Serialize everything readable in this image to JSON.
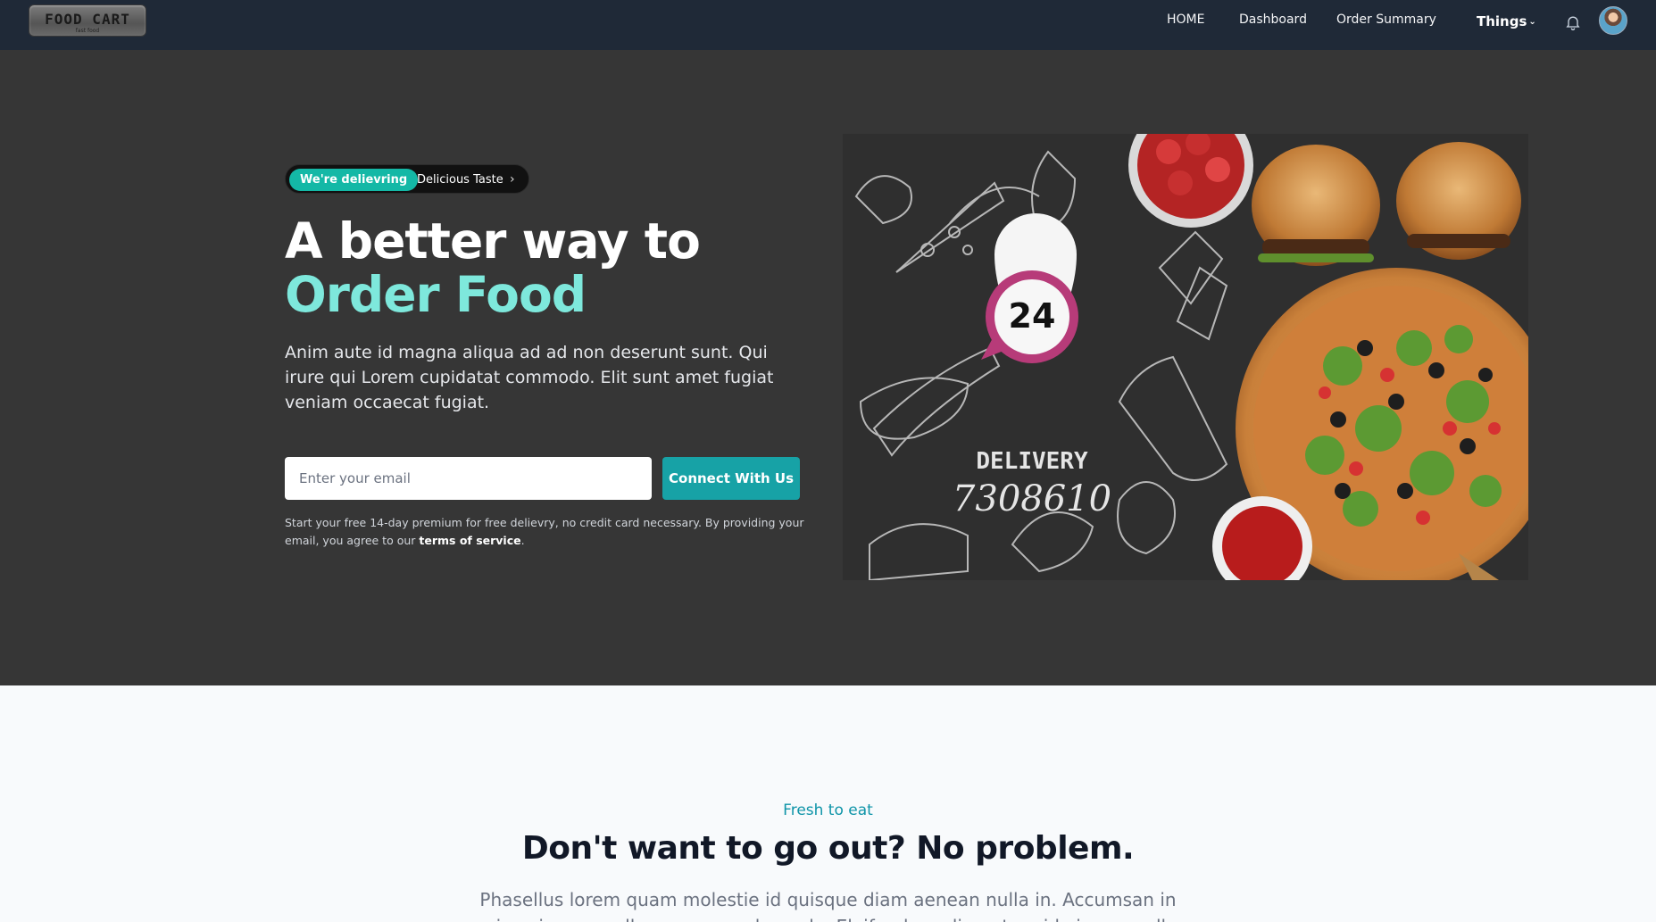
{
  "nav": {
    "logo_text": "FOOD CART",
    "logo_sub": "fast food",
    "links": [
      "HOME",
      "Dashboard",
      "Order Summary"
    ],
    "dropdown": "Things"
  },
  "hero": {
    "badge": "We're delievring",
    "badge_text": "Delicious Taste",
    "title_line1": "A better way to",
    "title_line2": "Order Food",
    "lead": "Anim aute id magna aliqua ad ad non deserunt sunt. Qui irure qui Lorem cupidatat commodo. Elit sunt amet fugiat veniam occaecat fugiat.",
    "email_placeholder": "Enter your email",
    "cta": "Connect With Us",
    "fine_print": "Start your free 14-day premium for free delievry, no credit card necessary. By providing your email, you agree to our",
    "terms": "terms of service",
    "image": {
      "pin_text": "24",
      "delivery_label": "DELIVERY",
      "delivery_number": "7308610"
    }
  },
  "feature": {
    "eyebrow": "Fresh to eat",
    "title": "Don't want to go out? No problem.",
    "text_line1": "Phasellus lorem quam molestie id quisque diam aenean nulla in. Accumsan in",
    "text_line2": "quis quis nunc, ullamcorper malesuada. Eleifend condimentum id viverra nulla."
  },
  "colors": {
    "navbar": "#1f2937",
    "hero_bg": "#363636",
    "accent": "#14b8a6",
    "title_accent": "#7ee8dc",
    "eyebrow": "#0e94a8"
  }
}
